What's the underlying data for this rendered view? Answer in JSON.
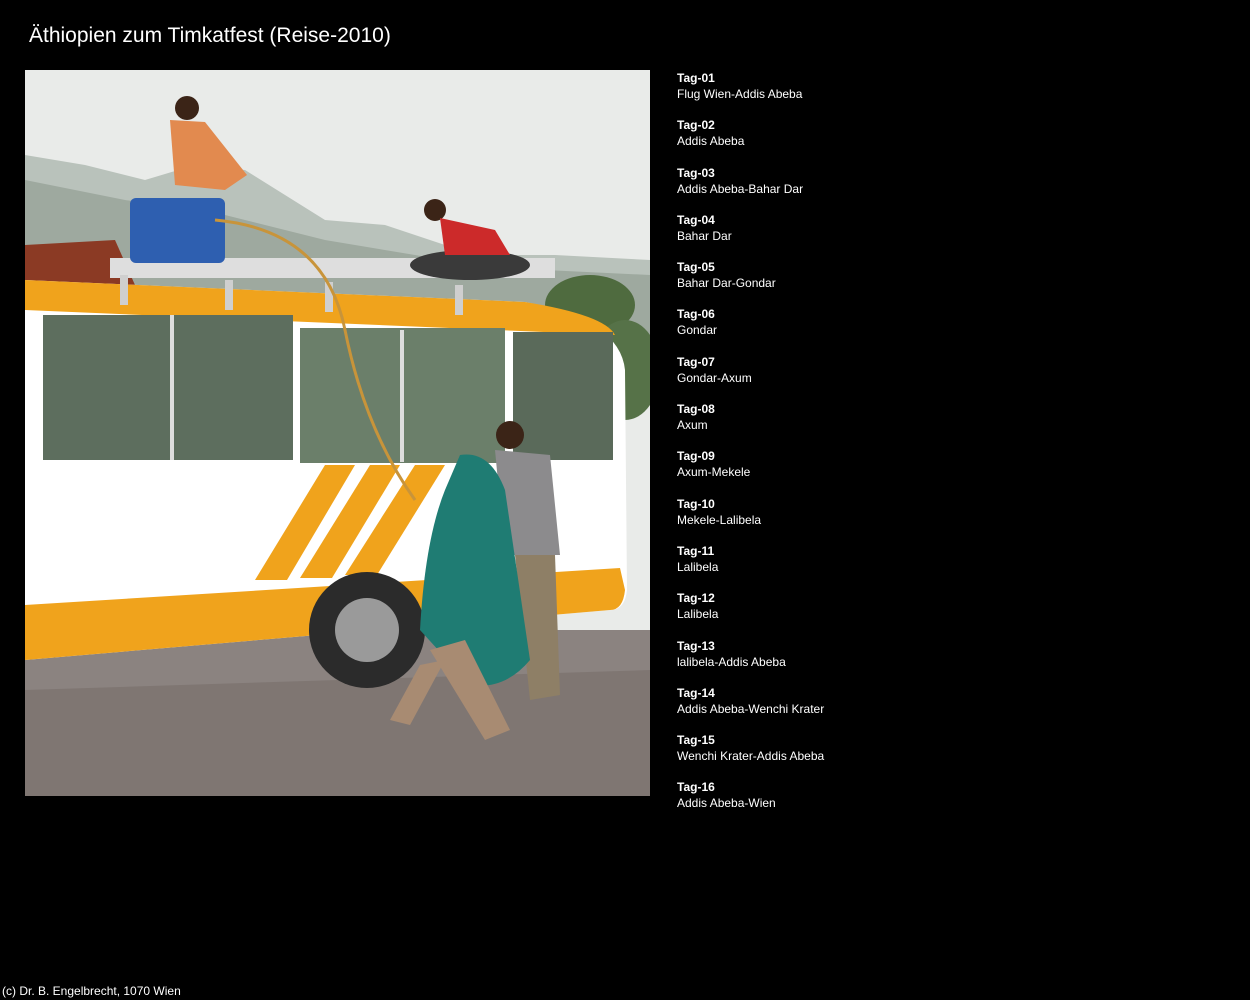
{
  "page": {
    "title": "Äthiopien zum Timkatfest (Reise-2010)"
  },
  "photo": {
    "description_icon": "photo-minibus-loading"
  },
  "days": [
    {
      "label": "Tag-01",
      "route": "Flug Wien-Addis Abeba"
    },
    {
      "label": "Tag-02",
      "route": "Addis Abeba"
    },
    {
      "label": "Tag-03",
      "route": "Addis Abeba-Bahar Dar"
    },
    {
      "label": "Tag-04",
      "route": "Bahar Dar"
    },
    {
      "label": "Tag-05",
      "route": "Bahar Dar-Gondar"
    },
    {
      "label": "Tag-06",
      "route": "Gondar"
    },
    {
      "label": "Tag-07",
      "route": "Gondar-Axum"
    },
    {
      "label": "Tag-08",
      "route": "Axum"
    },
    {
      "label": "Tag-09",
      "route": "Axum-Mekele"
    },
    {
      "label": "Tag-10",
      "route": "Mekele-Lalibela"
    },
    {
      "label": "Tag-11",
      "route": "Lalibela"
    },
    {
      "label": "Tag-12",
      "route": "Lalibela"
    },
    {
      "label": "Tag-13",
      "route": "lalibela-Addis Abeba"
    },
    {
      "label": "Tag-14",
      "route": "Addis Abeba-Wenchi Krater"
    },
    {
      "label": "Tag-15",
      "route": "Wenchi Krater-Addis Abeba"
    },
    {
      "label": "Tag-16",
      "route": "Addis Abeba-Wien"
    }
  ],
  "footer": {
    "copyright": "(c) Dr. B. Engelbrecht, 1070 Wien"
  },
  "colors": {
    "background": "#000000",
    "text": "#ffffff",
    "bus_yellow": "#f0a31c"
  }
}
